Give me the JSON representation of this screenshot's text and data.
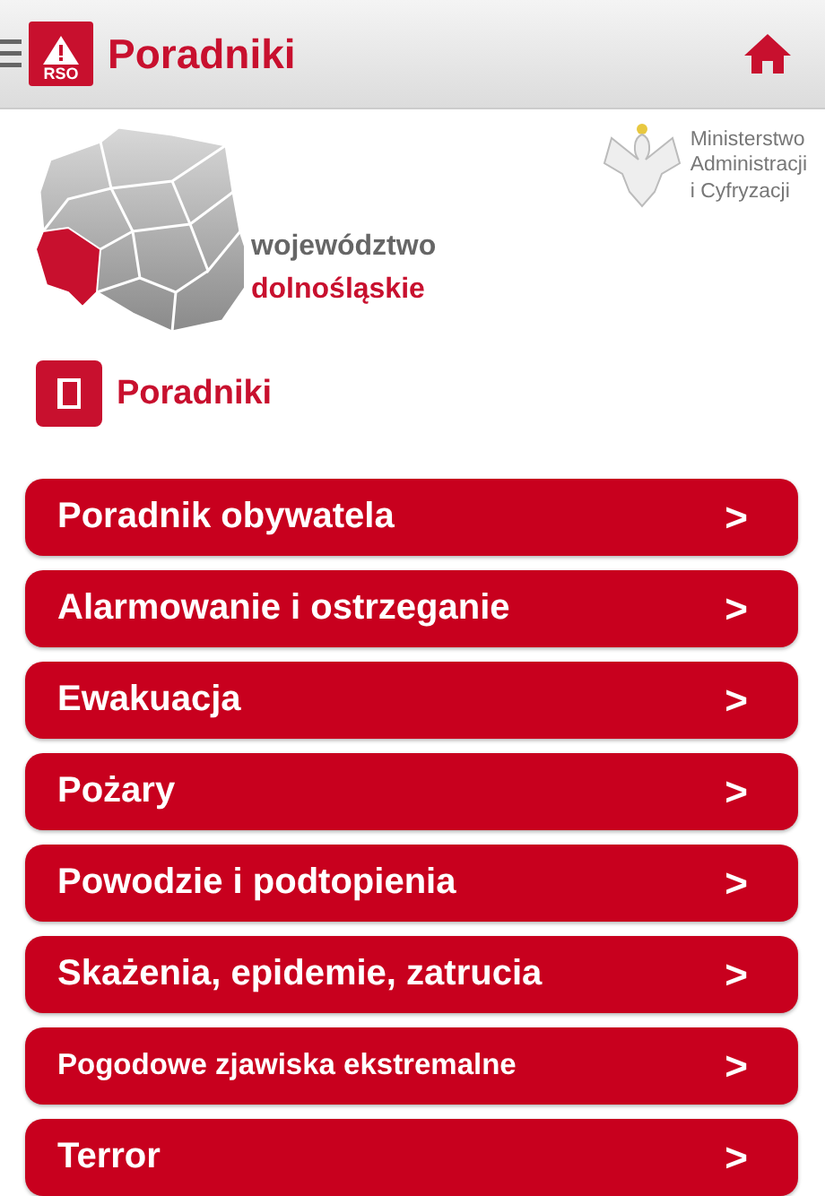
{
  "app_bar": {
    "logo_text": "RSO",
    "title": "Poradniki"
  },
  "region": {
    "label": "województwo",
    "name": "dolnośląskie"
  },
  "ministry": {
    "lines": [
      "Ministerstwo",
      "Administracji",
      "i Cyfryzacji"
    ]
  },
  "section": {
    "title": "Poradniki"
  },
  "guides": [
    {
      "label": "Poradnik obywatela",
      "chevron": ">",
      "kind": "normal"
    },
    {
      "label": "Alarmowanie i ostrzeganie",
      "chevron": ">",
      "kind": "normal"
    },
    {
      "label": "Ewakuacja",
      "chevron": ">",
      "kind": "normal"
    },
    {
      "label": "Pożary",
      "chevron": ">",
      "kind": "normal"
    },
    {
      "label": "Powodzie i podtopienia",
      "chevron": ">",
      "kind": "normal"
    },
    {
      "label": "Skażenia, epidemie, zatrucia",
      "chevron": ">",
      "kind": "normal"
    },
    {
      "label": "Pogodowe zjawiska ekstremalne",
      "chevron": ">",
      "kind": "small"
    },
    {
      "label": "Terror",
      "chevron": ">",
      "kind": "normal"
    }
  ]
}
